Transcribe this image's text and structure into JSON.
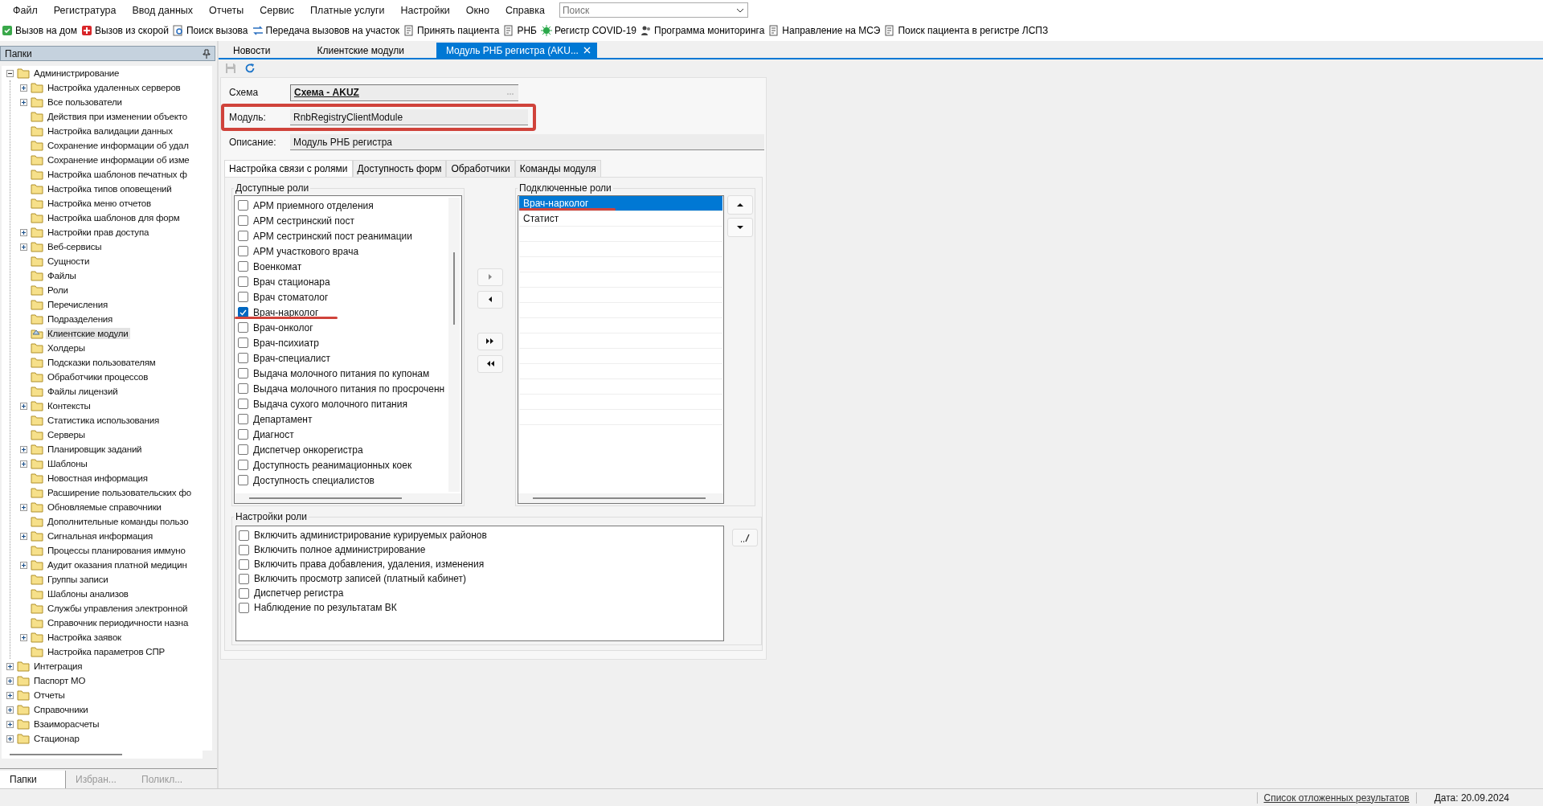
{
  "menu": [
    "Файл",
    "Регистратура",
    "Ввод данных",
    "Отчеты",
    "Сервис",
    "Платные услуги",
    "Настройки",
    "Окно",
    "Справка"
  ],
  "search": {
    "placeholder": "Поиск"
  },
  "toolbar": [
    {
      "label": "Вызов на дом",
      "kind": "home"
    },
    {
      "label": "Вызов из скорой",
      "kind": "ambulance"
    },
    {
      "label": "Поиск вызова",
      "kind": "search"
    },
    {
      "label": "Передача вызовов на участок",
      "kind": "transfer"
    },
    {
      "label": "Принять пациента",
      "kind": "doc"
    },
    {
      "label": "РНБ",
      "kind": "doc"
    },
    {
      "label": "Регистр COVID-19",
      "kind": "virus"
    },
    {
      "label": "Программа мониторинга",
      "kind": "people"
    },
    {
      "label": "Направление на МСЭ",
      "kind": "doc"
    },
    {
      "label": "Поиск пациента в регистре ЛСПЗ",
      "kind": "doc"
    }
  ],
  "sidebar": {
    "title": "Папки",
    "tree": [
      {
        "label": "Администрирование",
        "kind": "branch",
        "expanded": true,
        "selected": false,
        "children": [
          {
            "label": "Настройка удаленных серверов",
            "kind": "branch",
            "expanded": false,
            "selected": false
          },
          {
            "label": "Все пользователи",
            "kind": "branch",
            "expanded": false,
            "selected": false
          },
          {
            "label": "Действия при изменении объекто",
            "kind": "leaf",
            "selected": false
          },
          {
            "label": "Настройка валидации данных",
            "kind": "leaf",
            "selected": false
          },
          {
            "label": "Сохранение информации об удал",
            "kind": "leaf",
            "selected": false
          },
          {
            "label": "Сохранение информации об изме",
            "kind": "leaf",
            "selected": false
          },
          {
            "label": "Настройка шаблонов печатных ф",
            "kind": "leaf",
            "selected": false
          },
          {
            "label": "Настройка типов оповещений",
            "kind": "leaf",
            "selected": false
          },
          {
            "label": "Настройка меню отчетов",
            "kind": "leaf",
            "selected": false
          },
          {
            "label": "Настройка шаблонов для форм",
            "kind": "leaf",
            "selected": false
          },
          {
            "label": "Настройки прав доступа",
            "kind": "branch",
            "expanded": false,
            "selected": false
          },
          {
            "label": "Веб-сервисы",
            "kind": "branch",
            "expanded": false,
            "selected": false
          },
          {
            "label": "Сущности",
            "kind": "leaf",
            "selected": false
          },
          {
            "label": "Файлы",
            "kind": "leaf",
            "selected": false
          },
          {
            "label": "Роли",
            "kind": "leaf",
            "selected": false
          },
          {
            "label": "Перечисления",
            "kind": "leaf",
            "selected": false
          },
          {
            "label": "Подразделения",
            "kind": "leaf",
            "selected": false
          },
          {
            "label": "Клиентские модули",
            "kind": "leaf",
            "selected": true
          },
          {
            "label": "Холдеры",
            "kind": "leaf",
            "selected": false
          },
          {
            "label": "Подсказки пользователям",
            "kind": "leaf",
            "selected": false
          },
          {
            "label": "Обработчики процессов",
            "kind": "leaf",
            "selected": false
          },
          {
            "label": "Файлы лицензий",
            "kind": "leaf",
            "selected": false
          },
          {
            "label": "Контексты",
            "kind": "branch",
            "expanded": false,
            "selected": false
          },
          {
            "label": "Статистика использования",
            "kind": "leaf",
            "selected": false
          },
          {
            "label": "Серверы",
            "kind": "leaf",
            "selected": false
          },
          {
            "label": "Планировщик заданий",
            "kind": "branch",
            "expanded": false,
            "selected": false
          },
          {
            "label": "Шаблоны",
            "kind": "branch",
            "expanded": false,
            "selected": false
          },
          {
            "label": "Новостная информация",
            "kind": "leaf",
            "selected": false
          },
          {
            "label": "Расширение пользовательских фо",
            "kind": "leaf",
            "selected": false
          },
          {
            "label": "Обновляемые справочники",
            "kind": "branch",
            "expanded": false,
            "selected": false
          },
          {
            "label": "Дополнительные команды пользо",
            "kind": "leaf",
            "selected": false
          },
          {
            "label": "Сигнальная информация",
            "kind": "branch",
            "expanded": false,
            "selected": false
          },
          {
            "label": "Процессы планирования иммуно",
            "kind": "leaf",
            "selected": false
          },
          {
            "label": "Аудит оказания платной медицин",
            "kind": "branch",
            "expanded": false,
            "selected": false
          },
          {
            "label": "Группы записи",
            "kind": "leaf",
            "selected": false
          },
          {
            "label": "Шаблоны анализов",
            "kind": "leaf",
            "selected": false
          },
          {
            "label": "Службы управления электронной",
            "kind": "leaf",
            "selected": false
          },
          {
            "label": "Справочник периодичности назна",
            "kind": "leaf",
            "selected": false
          },
          {
            "label": "Настройка заявок",
            "kind": "branch",
            "expanded": false,
            "selected": false
          },
          {
            "label": "Настройка параметров СПР",
            "kind": "leaf",
            "selected": false
          }
        ]
      },
      {
        "label": "Интеграция",
        "kind": "branch",
        "expanded": false,
        "selected": false
      },
      {
        "label": "Паспорт МО",
        "kind": "branch",
        "expanded": false,
        "selected": false
      },
      {
        "label": "Отчеты",
        "kind": "branch",
        "expanded": false,
        "selected": false
      },
      {
        "label": "Справочники",
        "kind": "branch",
        "expanded": false,
        "selected": false
      },
      {
        "label": "Взаиморасчеты",
        "kind": "branch",
        "expanded": false,
        "selected": false
      },
      {
        "label": "Стационар",
        "kind": "branch",
        "expanded": false,
        "selected": false
      }
    ],
    "tabs": [
      {
        "label": "Папки",
        "selected": true
      },
      {
        "label": "Избран...",
        "selected": false
      },
      {
        "label": "Поликл...",
        "selected": false
      }
    ]
  },
  "tabs": [
    {
      "label": "Новости",
      "selected": false,
      "closable": false
    },
    {
      "label": "Клиентские модули",
      "selected": false,
      "closable": false
    },
    {
      "label": "Модуль РНБ регистра (AKU...",
      "selected": true,
      "closable": true
    }
  ],
  "form": {
    "fields": [
      {
        "label": "Схема",
        "value": "Схема - AKUZ",
        "kind": "lookup",
        "highlighted": false
      },
      {
        "label": "Модуль:",
        "value": "RnbRegistryClientModule",
        "kind": "text",
        "highlighted": true
      },
      {
        "label": "Описание:",
        "value": "Модуль РНБ регистра",
        "kind": "text",
        "highlighted": false
      }
    ],
    "subtabs": [
      {
        "label": "Настройка связи с ролями",
        "selected": true
      },
      {
        "label": "Доступность форм",
        "selected": false
      },
      {
        "label": "Обработчики",
        "selected": false
      },
      {
        "label": "Команды модуля",
        "selected": false
      }
    ],
    "available_roles": {
      "title": "Доступные роли",
      "items": [
        {
          "label": "АРМ приемного отделения",
          "checked": false,
          "annotated": false
        },
        {
          "label": "АРМ сестринский пост",
          "checked": false,
          "annotated": false
        },
        {
          "label": "АРМ сестринский пост реанимации",
          "checked": false,
          "annotated": false
        },
        {
          "label": "АРМ участкового врача",
          "checked": false,
          "annotated": false
        },
        {
          "label": "Военкомат",
          "checked": false,
          "annotated": false
        },
        {
          "label": "Врач стационара",
          "checked": false,
          "annotated": false
        },
        {
          "label": "Врач стоматолог",
          "checked": false,
          "annotated": false
        },
        {
          "label": "Врач-нарколог",
          "checked": true,
          "annotated": true
        },
        {
          "label": "Врач-онколог",
          "checked": false,
          "annotated": false
        },
        {
          "label": "Врач-психиатр",
          "checked": false,
          "annotated": false
        },
        {
          "label": "Врач-специалист",
          "checked": false,
          "annotated": false
        },
        {
          "label": "Выдача молочного питания по купонам",
          "checked": false,
          "annotated": false
        },
        {
          "label": "Выдача молочного питания по просроченн",
          "checked": false,
          "annotated": false
        },
        {
          "label": "Выдача сухого молочного питания",
          "checked": false,
          "annotated": false
        },
        {
          "label": "Департамент",
          "checked": false,
          "annotated": false
        },
        {
          "label": "Диагност",
          "checked": false,
          "annotated": false
        },
        {
          "label": "Диспетчер онкорегистра",
          "checked": false,
          "annotated": false
        },
        {
          "label": "Доступность реанимационных коек",
          "checked": false,
          "annotated": false
        },
        {
          "label": "Доступность специалистов",
          "checked": false,
          "annotated": false
        }
      ]
    },
    "connected_roles": {
      "title": "Подключенные роли",
      "items": [
        {
          "label": "Врач-нарколог",
          "selected": true,
          "annotated": true
        },
        {
          "label": "Статист",
          "selected": false,
          "annotated": false
        }
      ]
    },
    "role_settings": {
      "title": "Настройки роли",
      "items": [
        {
          "label": "Включить администрирование курируемых районов",
          "checked": false
        },
        {
          "label": "Включить полное администрирование",
          "checked": false
        },
        {
          "label": "Включить права добавления, удаления, изменения",
          "checked": false
        },
        {
          "label": "Включить просмотр записей (платный кабинет)",
          "checked": false
        },
        {
          "label": "Диспетчер регистра",
          "checked": false
        },
        {
          "label": "Наблюдение по результатам ВК",
          "checked": false
        }
      ]
    }
  },
  "status_bar": {
    "link": "Список отложенных результатов",
    "date": "Дата: 20.09.2024"
  }
}
